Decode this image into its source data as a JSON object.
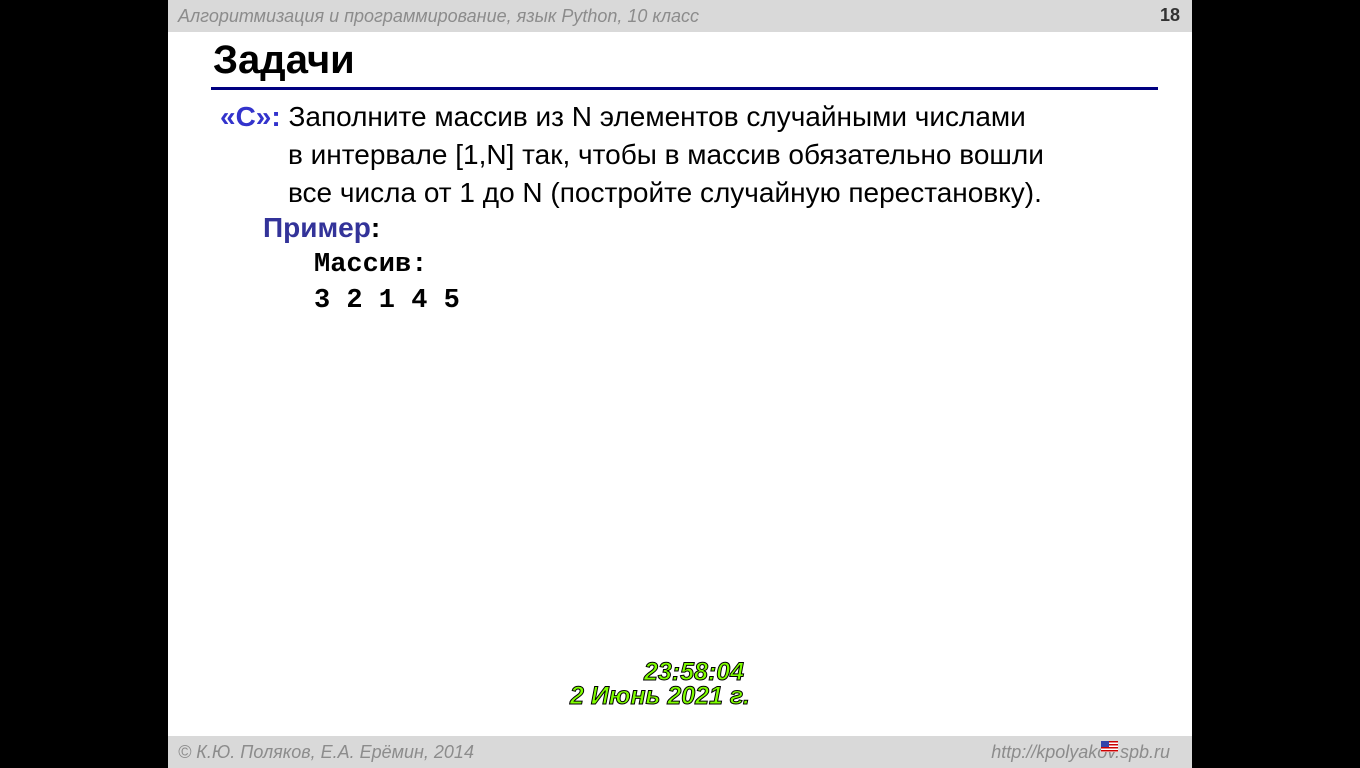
{
  "header": {
    "course": "Алгоритмизация и программирование, язык Python, 10 класс",
    "page": "18"
  },
  "title": "Задачи",
  "task": {
    "label": "«C»:",
    "lines": [
      "Заполните массив из N элементов случайными числами",
      "в интервале [1,N] так, чтобы в массив обязательно вошли",
      "все числа от 1 до N (постройте случайную перестановку)."
    ]
  },
  "example": {
    "label": "Пример",
    "colon": ":",
    "array_label": "Массив:",
    "array_values": "3 2 1 4 5"
  },
  "clock": {
    "time": "23:58:04",
    "date": "2 Июнь 2021 г."
  },
  "footer": {
    "copyright": "© К.Ю. Поляков, Е.А. Ерёмин, 2014",
    "url": "http://kpolyakov.spb.ru"
  }
}
